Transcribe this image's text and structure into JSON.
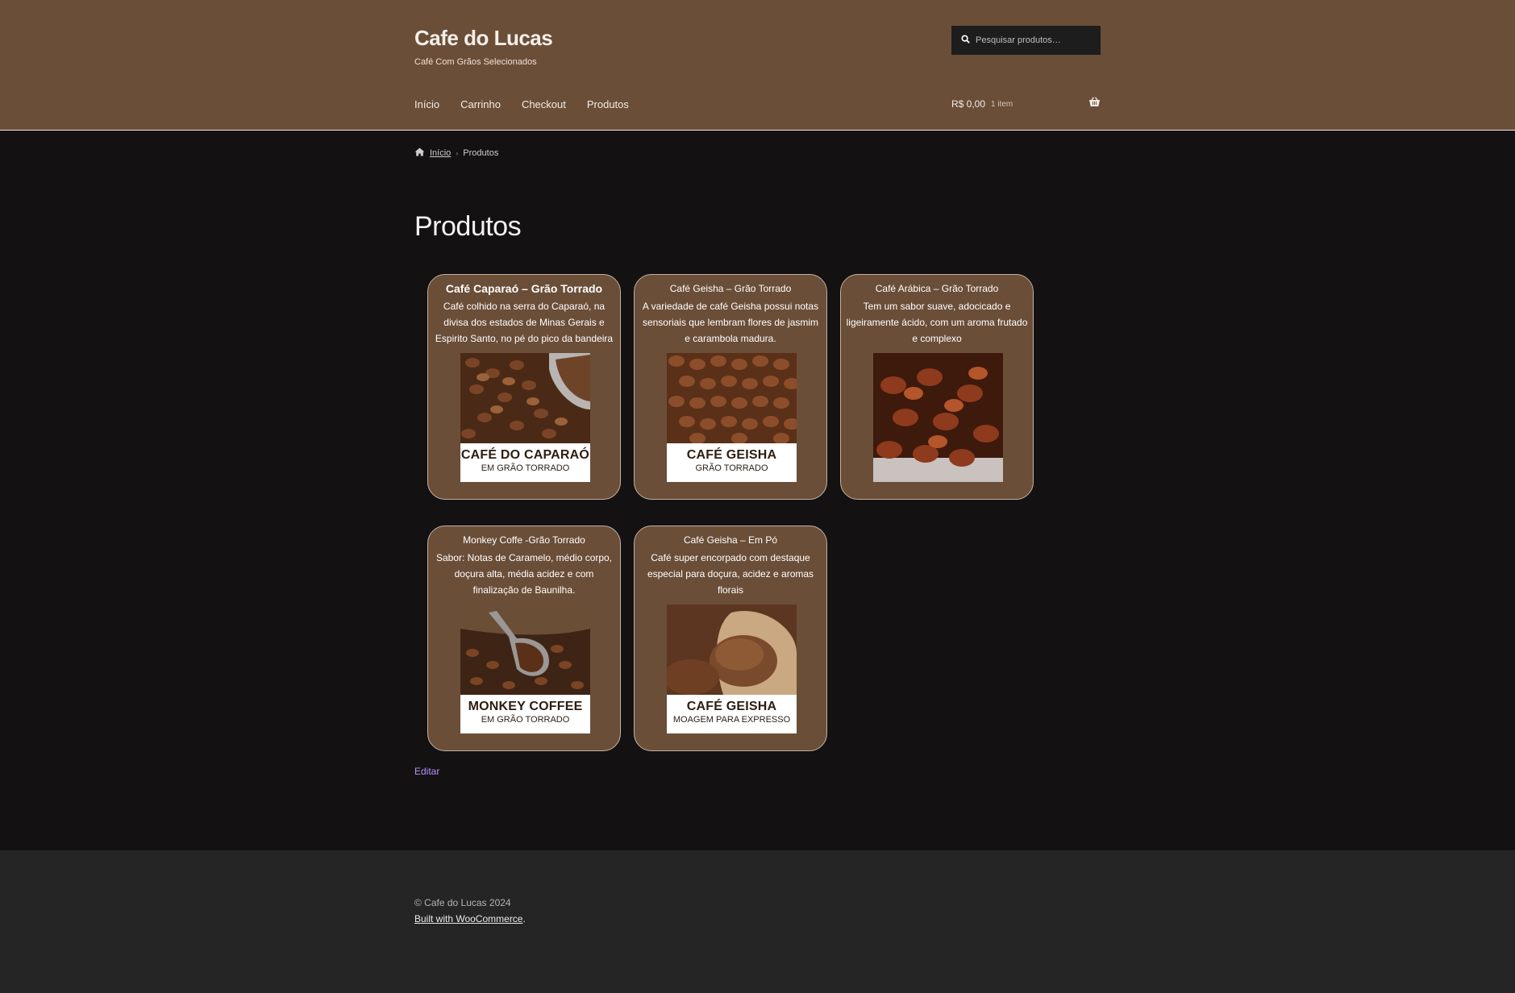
{
  "site": {
    "title": "Cafe do Lucas",
    "tagline": "Café Com Grãos Selecionados"
  },
  "search": {
    "placeholder": "Pesquisar produtos…"
  },
  "nav": {
    "items": [
      {
        "label": "Início"
      },
      {
        "label": "Carrinho"
      },
      {
        "label": "Checkout"
      },
      {
        "label": "Produtos"
      }
    ]
  },
  "cart": {
    "amount": "R$ 0,00",
    "count": "1 item"
  },
  "breadcrumb": {
    "home": "Início",
    "current": "Produtos"
  },
  "page": {
    "title": "Produtos",
    "edit_label": "Editar"
  },
  "products": [
    {
      "name": "Café Caparaó – Grão Torrado",
      "description": "Café colhido na serra do Caparaó, na divisa dos estados de Minas Gerais e Espirito Santo, no pé do pico da bandeira",
      "label_line1": "CAFÉ DO CAPARAÓ",
      "label_line2": "EM GRÃO TORRADO"
    },
    {
      "name": "Café Geisha – Grão Torrado",
      "description": "A variedade de café Geisha possui notas sensoriais que lembram flores de jasmim e carambola madura.",
      "label_line1": "CAFÉ GEISHA",
      "label_line2": "GRÃO TORRADO"
    },
    {
      "name": "Café Arábica – Grão Torrado",
      "description": "Tem um sabor suave, adocicado e ligeiramente ácido, com um aroma frutado e complexo"
    },
    {
      "name": "Monkey Coffe -Grão Torrado",
      "description": "Sabor: Notas de Caramelo, médio corpo, doçura alta, média acidez e com finalização de Baunilha.",
      "label_line1": "MONKEY COFFEE",
      "label_line2": "EM GRÃO TORRADO"
    },
    {
      "name": "Café Geisha – Em Pó",
      "description": "Café super encorpado com destaque especial para doçura, acidez e aromas florais",
      "label_line1": "CAFÉ GEISHA",
      "label_line2": "MOAGEM PARA EXPRESSO"
    }
  ],
  "footer": {
    "copyright": "© Cafe do Lucas 2024",
    "built_with": "Built with WooCommerce",
    "built_suffix": "."
  },
  "colors": {
    "header_bg": "#6b4e38",
    "body_bg": "#131112",
    "footer_bg": "#252525",
    "card_bg": "#6b4e38",
    "link_edit": "#b693ff"
  }
}
